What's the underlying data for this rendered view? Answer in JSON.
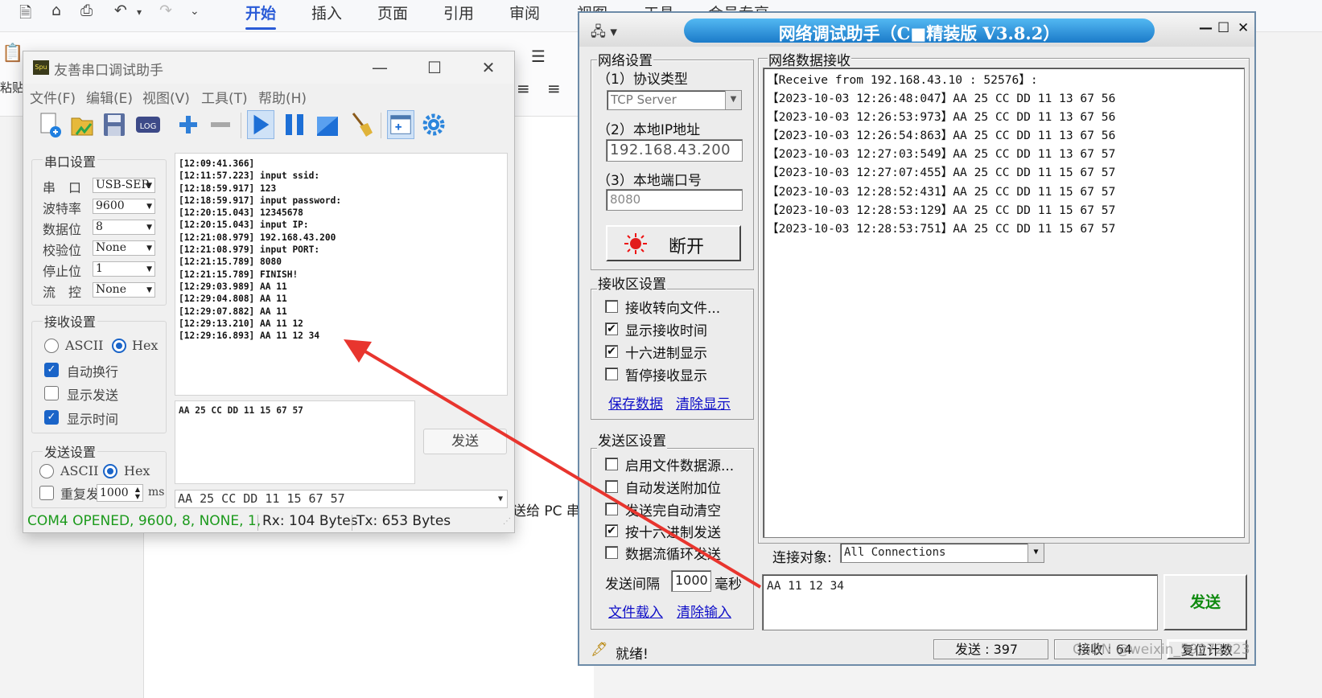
{
  "background_app": {
    "tabs": [
      "开始",
      "插入",
      "页面",
      "引用",
      "审阅",
      "视图",
      "工具",
      "会员专享"
    ],
    "active_tab": "开始",
    "paste_label": "粘贴",
    "doc_text": "送给 PC 串"
  },
  "serial": {
    "title": "友善串口调试助手",
    "menu": [
      "文件(F)",
      "编辑(E)",
      "视图(V)",
      "工具(T)",
      "帮助(H)"
    ],
    "port_settings": {
      "group": "串口设置",
      "fields": [
        {
          "label": "串　口",
          "value": "USB-SER"
        },
        {
          "label": "波特率",
          "value": "9600"
        },
        {
          "label": "数据位",
          "value": "8"
        },
        {
          "label": "校验位",
          "value": "None"
        },
        {
          "label": "停止位",
          "value": "1"
        },
        {
          "label": "流　控",
          "value": "None"
        }
      ]
    },
    "recv_settings": {
      "group": "接收设置",
      "ascii": "ASCII",
      "hex": "Hex",
      "hex_selected": true,
      "auto_wrap": {
        "label": "自动换行",
        "checked": true
      },
      "show_send": {
        "label": "显示发送",
        "checked": false
      },
      "show_time": {
        "label": "显示时间",
        "checked": true
      }
    },
    "send_settings": {
      "group": "发送设置",
      "ascii": "ASCII",
      "hex": "Hex",
      "hex_selected": true,
      "repeat": {
        "label": "重复发",
        "checked": false
      },
      "interval": "1000",
      "unit": "ms"
    },
    "rx_lines": [
      "[12:09:41.366]",
      "[12:11:57.223] input ssid:",
      "[12:18:59.917] 123",
      "[12:18:59.917] input password:",
      "[12:20:15.043] 12345678",
      "[12:20:15.043] input IP:",
      "[12:21:08.979] 192.168.43.200",
      "[12:21:08.979] input PORT:",
      "[12:21:15.789] 8080",
      "[12:21:15.789] FINISH!",
      "[12:29:03.989] AA 11",
      "[12:29:04.808] AA 11",
      "[12:29:07.882] AA 11",
      "[12:29:13.210] AA 11 12",
      "[12:29:16.893] AA 11 12 34"
    ],
    "tx_text": "AA 25 CC DD 11 15 67 57",
    "send_button": "发送",
    "history_value": "AA 25 CC DD 11 15 67 57",
    "status": {
      "port": "COM4 OPENED, 9600, 8, NONE, 1,",
      "rx": "Rx: 104 Bytes",
      "tx": "Tx: 653 Bytes"
    }
  },
  "network": {
    "title": "网络调试助手（C■精装版 V3.8.2）",
    "settings": {
      "group": "网络设置",
      "protocol_label": "（1）协议类型",
      "protocol_value": "TCP Server",
      "ip_label": "（2）本地IP地址",
      "ip_value": "192.168.43.200",
      "port_label": "（3）本地端口号",
      "port_value": "8080",
      "disconnect_button": "断开"
    },
    "recv_settings": {
      "group": "接收区设置",
      "options": [
        {
          "label": "接收转向文件...",
          "checked": false
        },
        {
          "label": "显示接收时间",
          "checked": true
        },
        {
          "label": "十六进制显示",
          "checked": true
        },
        {
          "label": "暂停接收显示",
          "checked": false
        }
      ],
      "save_link": "保存数据",
      "clear_link": "清除显示"
    },
    "send_settings": {
      "group": "发送区设置",
      "options": [
        {
          "label": "启用文件数据源...",
          "checked": false
        },
        {
          "label": "自动发送附加位",
          "checked": false
        },
        {
          "label": "发送完自动清空",
          "checked": false
        },
        {
          "label": "按十六进制发送",
          "checked": true
        },
        {
          "label": "数据流循环发送",
          "checked": false
        }
      ],
      "interval_label": "发送间隔",
      "interval_value": "1000",
      "interval_unit": "毫秒",
      "load_link": "文件载入",
      "clear_link": "清除输入"
    },
    "rx_group": "网络数据接收",
    "rx_lines": [
      "【Receive from 192.168.43.10 : 52576】:",
      "【2023-10-03 12:26:48:047】AA 25 CC DD 11 13 67 56",
      "【2023-10-03 12:26:53:973】AA 25 CC DD 11 13 67 56",
      "【2023-10-03 12:26:54:863】AA 25 CC DD 11 13 67 56",
      "【2023-10-03 12:27:03:549】AA 25 CC DD 11 13 67 57",
      "【2023-10-03 12:27:07:455】AA 25 CC DD 11 15 67 57",
      "【2023-10-03 12:28:52:431】AA 25 CC DD 11 15 67 57",
      "【2023-10-03 12:28:53:129】AA 25 CC DD 11 15 67 57",
      "【2023-10-03 12:28:53:751】AA 25 CC DD 11 15 67 57"
    ],
    "target_label": "连接对象:",
    "target_value": "All Connections",
    "tx_text": "AA 11 12 34",
    "send_button": "发送",
    "status": {
      "ready": "就绪!",
      "sent": "发送 : 397",
      "received": "接收 : 64",
      "reset": "复位计数"
    }
  },
  "watermark": "CSDN @weixin_59272023",
  "colors": {
    "accent_blue": "#1a64c8",
    "status_green": "#1c9a1c",
    "arrow_red": "#e8352e",
    "net_title_blue": "#1b7bc9"
  }
}
